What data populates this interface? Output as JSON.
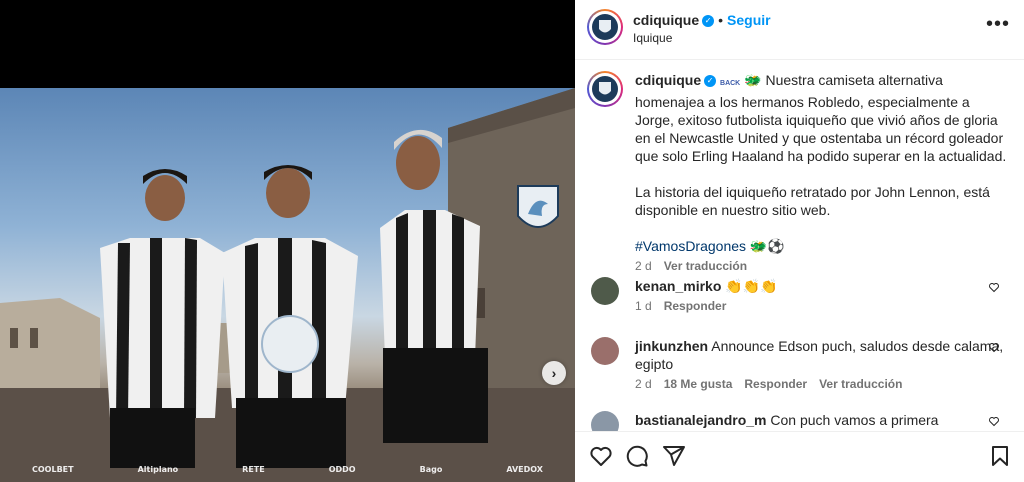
{
  "post": {
    "username": "cdiquique",
    "follow_label": "Seguir",
    "location": "Iquique",
    "more_label": "•••",
    "verified_mark": "✓"
  },
  "media": {
    "next_label": "›",
    "sponsors": [
      "COOLBET",
      "Altiplano",
      "",
      "",
      "",
      "RETE",
      "",
      "ODDO",
      "Bago",
      "AVEDOX"
    ]
  },
  "caption": {
    "username": "cdiquique",
    "back_label": "BACK",
    "para1": "Nuestra camiseta alternativa homenajea a los hermanos Robledo, especialmente a Jorge, exitoso futbolista iquiqueño que vivió años de gloria en el Newcastle United y que ostentaba un récord goleador que solo Erling Haaland ha podido superar en la actualidad.",
    "para2": "La historia del iquiqueño retratado por John Lennon, está disponible en nuestro sitio web.",
    "hashtag": "#VamosDragones",
    "emoji_tail": "🐲⚽",
    "time": "2 d",
    "translate": "Ver traducción"
  },
  "comments": [
    {
      "user": "kenan_mirko",
      "text": "👏👏👏",
      "time": "1 d",
      "likes": "",
      "reply": "Responder",
      "translate": ""
    },
    {
      "user": "jinkunzhen",
      "text": "Announce Edson puch, saludos desde calama, egipto",
      "time": "2 d",
      "likes": "18 Me gusta",
      "reply": "Responder",
      "translate": "Ver traducción"
    },
    {
      "user": "bastianalejandro_m",
      "text": "Con puch vamos a primera",
      "time": "",
      "likes": "",
      "reply": "",
      "translate": ""
    }
  ],
  "colors": {
    "accent": "#0095f6",
    "hashtag": "#00376b",
    "muted": "#737373"
  },
  "icons": [
    "heart-icon",
    "comment-icon",
    "share-icon",
    "save-icon",
    "more-icon",
    "verified-icon",
    "next-arrow-icon"
  ]
}
